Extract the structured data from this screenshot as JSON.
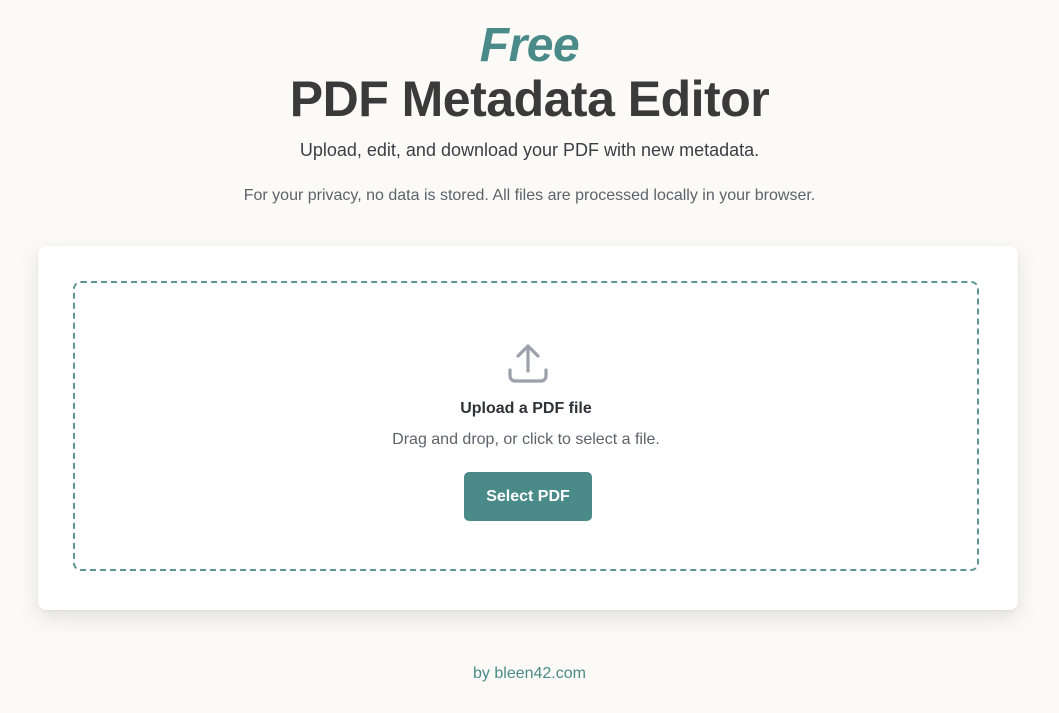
{
  "header": {
    "free_label": "Free",
    "title": "PDF Metadata Editor",
    "subtitle": "Upload, edit, and download your PDF with new metadata.",
    "privacy_note": "For your privacy, no data is stored. All files are processed locally in your browser."
  },
  "upload": {
    "icon": "upload-icon",
    "title": "Upload a PDF file",
    "hint": "Drag and drop, or click to select a file.",
    "button_label": "Select PDF"
  },
  "footer": {
    "prefix": "by ",
    "link_text": "bleen42.com"
  },
  "colors": {
    "accent": "#4a8a89",
    "heading": "#3a3a3a",
    "background": "#fbfaf7",
    "icon": "#9aa1aa"
  }
}
